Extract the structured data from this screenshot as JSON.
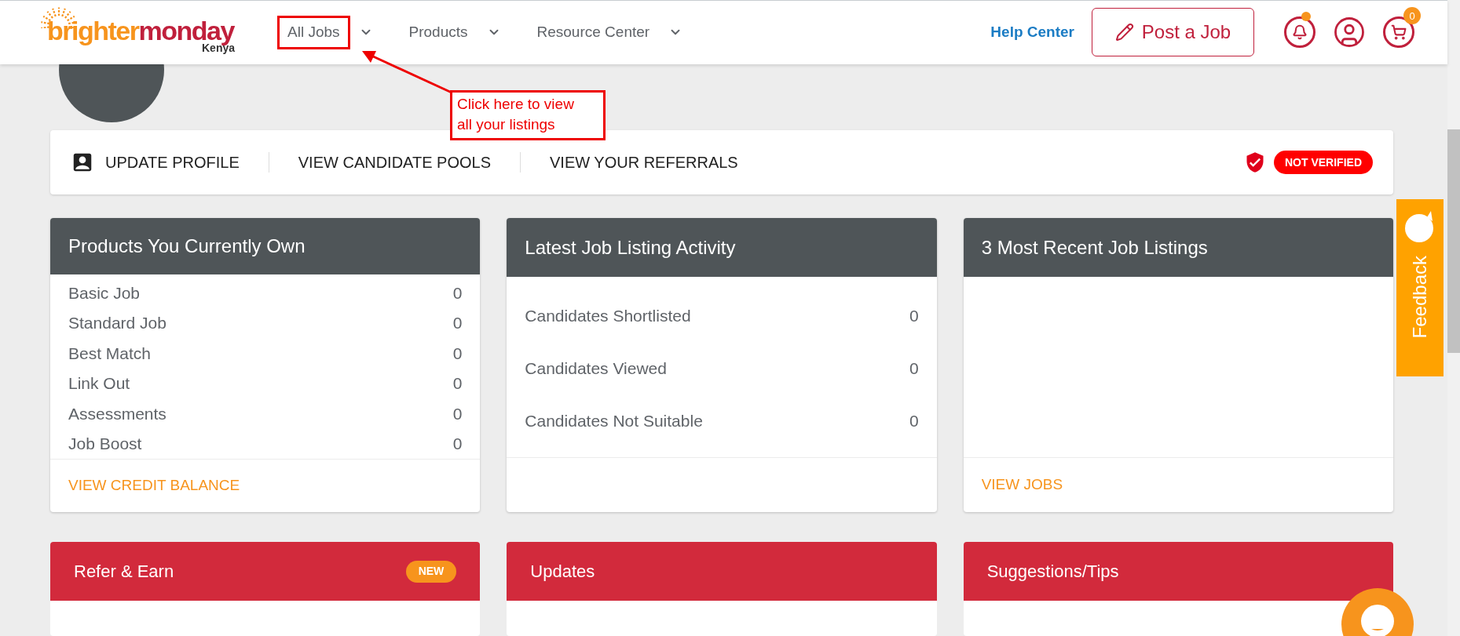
{
  "header": {
    "logo": {
      "word_1": "brighter",
      "word_2": "monday",
      "country": "Kenya"
    },
    "nav": [
      {
        "label": "All Jobs",
        "highlighted": true
      },
      {
        "label": "Products",
        "highlighted": false
      },
      {
        "label": "Resource Center",
        "highlighted": false
      }
    ],
    "help_link": "Help Center",
    "post_button": "Post a Job",
    "notification_dot": true,
    "cart_count": "0"
  },
  "annotation": {
    "text": "Click here to view all your listings"
  },
  "profile_bar": {
    "links": [
      "UPDATE PROFILE",
      "VIEW CANDIDATE POOLS",
      "VIEW YOUR REFERRALS"
    ],
    "verification": "NOT VERIFIED"
  },
  "cards": [
    {
      "kind": "counts",
      "title": "Products You Currently Own",
      "rows": [
        {
          "label": "Basic Job",
          "value": "0"
        },
        {
          "label": "Standard Job",
          "value": "0"
        },
        {
          "label": "Best Match",
          "value": "0"
        },
        {
          "label": "Link Out",
          "value": "0"
        },
        {
          "label": "Assessments",
          "value": "0"
        },
        {
          "label": "Job Boost",
          "value": "0"
        }
      ],
      "footer_link": "VIEW CREDIT BALANCE"
    },
    {
      "kind": "activity",
      "title": "Latest Job Listing Activity",
      "rows": [
        {
          "label": "Candidates Shortlisted",
          "value": "0"
        },
        {
          "label": "Candidates Viewed",
          "value": "0"
        },
        {
          "label": "Candidates Not Suitable",
          "value": "0"
        }
      ]
    },
    {
      "kind": "listings",
      "title": "3 Most Recent Job Listings",
      "footer_link": "VIEW JOBS"
    }
  ],
  "bottom_cards": [
    {
      "title": "Refer & Earn",
      "badge": "NEW"
    },
    {
      "title": "Updates"
    },
    {
      "title": "Suggestions/Tips"
    }
  ],
  "feedback_tab": "Feedback"
}
